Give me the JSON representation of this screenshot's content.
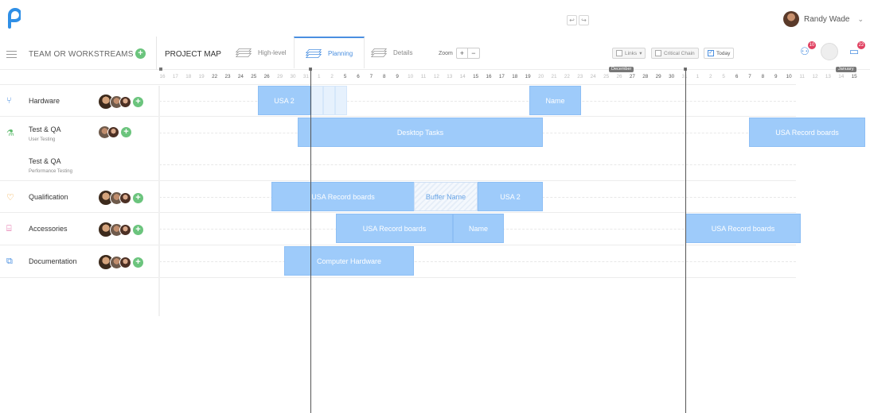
{
  "app": {
    "logo_letter": "p"
  },
  "user": {
    "name": "Randy Wade"
  },
  "undo_redo": {
    "undo": "↩",
    "redo": "↪"
  },
  "sidebar_header": {
    "title": "TEAM OR WORKSTREAMS"
  },
  "view": {
    "project_map": "PROJECT MAP",
    "tabs": [
      {
        "label": "High-level",
        "active": false
      },
      {
        "label": "Planning",
        "active": true
      },
      {
        "label": "Details",
        "active": false
      }
    ],
    "zoom_label": "Zoom",
    "zoom_in": "+",
    "zoom_out": "−",
    "links_label": "Links",
    "critical_chain_label": "Critical Chain",
    "today_label": "Today",
    "today_checked": true
  },
  "notifications": {
    "team_count": "10",
    "messages_count": "22"
  },
  "timeline": {
    "months": [
      "December",
      "January"
    ],
    "days": [
      "16",
      "17",
      "18",
      "19",
      "22",
      "23",
      "24",
      "25",
      "26",
      "29",
      "30",
      "31",
      "1",
      "2",
      "5",
      "6",
      "7",
      "8",
      "9",
      "10",
      "11",
      "12",
      "13",
      "14",
      "15",
      "16",
      "17",
      "18",
      "19",
      "20",
      "21",
      "22",
      "23",
      "24",
      "25",
      "26",
      "27",
      "28",
      "29",
      "30",
      "31",
      "1",
      "2",
      "5",
      "6",
      "7",
      "8",
      "9",
      "10",
      "11",
      "12",
      "13",
      "14",
      "15"
    ],
    "strong_days": [
      "22",
      "23",
      "24",
      "25",
      "26",
      "1",
      "2",
      "5",
      "6",
      "7",
      "8",
      "9",
      "15",
      "16",
      "17",
      "18",
      "19",
      "26",
      "27",
      "28",
      "29",
      "5",
      "6",
      "7",
      "8",
      "9",
      "15"
    ]
  },
  "rows": [
    {
      "name": "Hardware",
      "sub": "",
      "icon": "tuning-fork-icon",
      "icon_glyph": "⑂",
      "icon_color": "#4a8fe0",
      "avatars": 3
    },
    {
      "name": "Test & QA",
      "sub": "User Testing",
      "icon": "flask-icon",
      "icon_glyph": "⚗",
      "icon_color": "#5dbb6d",
      "avatars": 2
    },
    {
      "name": "Test & QA",
      "sub": "Performance Testing",
      "icon": "",
      "icon_glyph": "",
      "icon_color": "",
      "avatars": 0
    },
    {
      "name": "Qualification",
      "sub": "",
      "icon": "lightbulb-icon",
      "icon_glyph": "♡",
      "icon_color": "#f0a030",
      "avatars": 3
    },
    {
      "name": "Accessories",
      "sub": "",
      "icon": "monitor-icon",
      "icon_glyph": "⌸",
      "icon_color": "#e060a0",
      "avatars": 3
    },
    {
      "name": "Documentation",
      "sub": "",
      "icon": "documents-icon",
      "icon_glyph": "⧉",
      "icon_color": "#4a8fe0",
      "avatars": 3
    }
  ],
  "tasks": [
    {
      "row": 0,
      "label": "USA 2",
      "type": "task"
    },
    {
      "row": 0,
      "label": "Name",
      "type": "task"
    },
    {
      "row": 1,
      "label": "Desktop Tasks",
      "type": "task"
    },
    {
      "row": 1,
      "label": "USA Record boards",
      "type": "task"
    },
    {
      "row": 3,
      "label": "USA Record boards",
      "type": "task"
    },
    {
      "row": 3,
      "label": "Buffer Name",
      "type": "buffer"
    },
    {
      "row": 3,
      "label": "USA 2",
      "type": "task"
    },
    {
      "row": 4,
      "label": "USA Record boards",
      "type": "task"
    },
    {
      "row": 4,
      "label": "Name",
      "type": "task"
    },
    {
      "row": 4,
      "label": "USA Record boards",
      "type": "task"
    },
    {
      "row": 5,
      "label": "Computer Hardware",
      "type": "task"
    }
  ]
}
